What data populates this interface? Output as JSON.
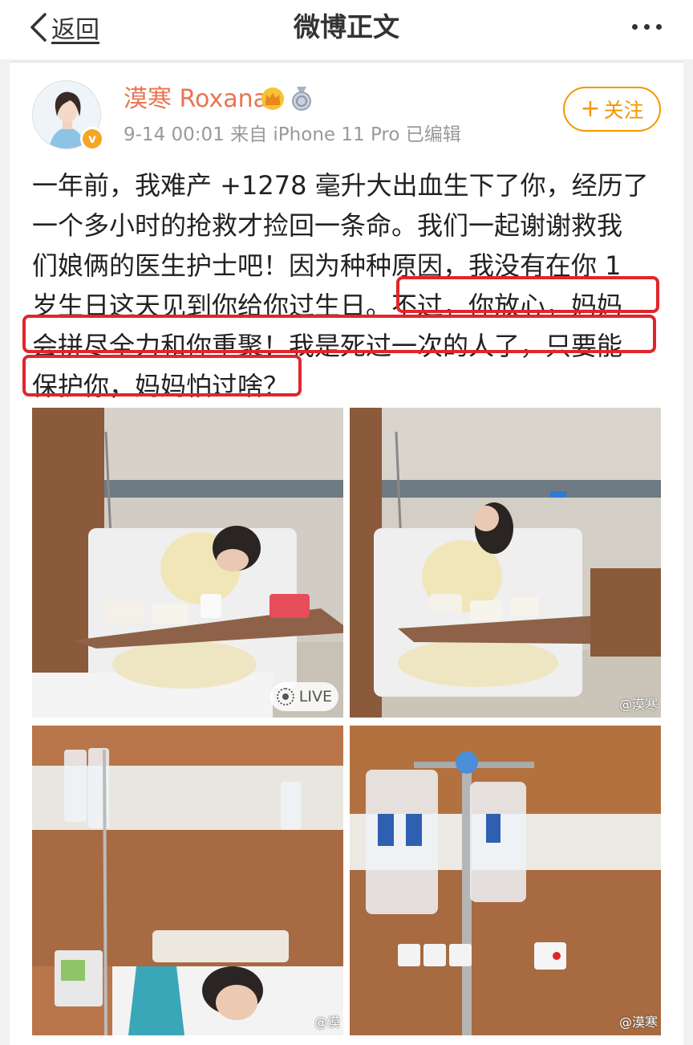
{
  "nav": {
    "back_label": "返回",
    "title": "微博正文"
  },
  "post": {
    "user_name": "漠寒 Roxana",
    "verify_mark": "v",
    "meta": "9-14 00:01  来自 iPhone 11 Pro  已编辑",
    "follow_label": "关注",
    "text_lines": [
      "一年前，我难产 +1278 毫升大出血生下了你，经历了",
      "一个多小时的抢救才捡回一条命。我们一起谢谢救我",
      "们娘俩的医生护士吧！因为种种原因，我没有在你 1",
      "岁生日这天见到你给你过生日。不过，你放心，妈妈",
      "会拼尽全力和你重聚！我是死过一次的人了，只要能",
      "保护你，妈妈怕过啥？"
    ],
    "photos": {
      "live_label": "LIVE",
      "watermark": "@漠寒",
      "watermark_short": "@漠"
    }
  },
  "colors": {
    "accent": "#eb7350",
    "follow": "#f39700",
    "highlight": "#e0262c"
  }
}
